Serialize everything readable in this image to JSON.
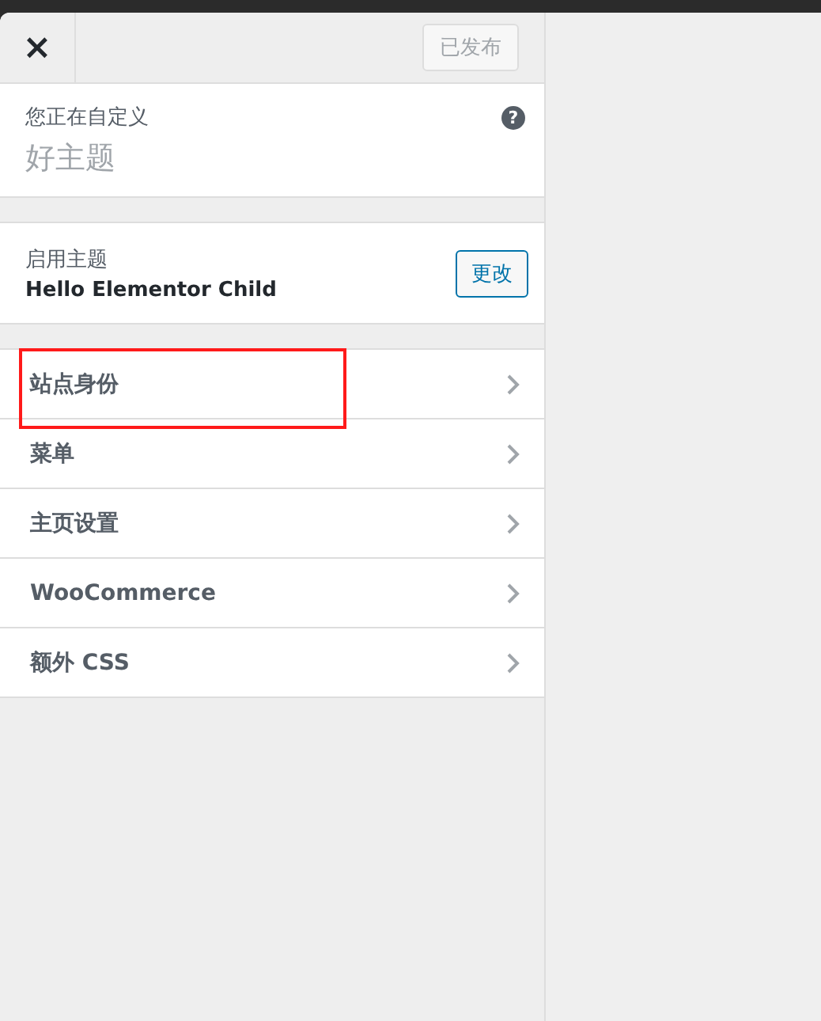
{
  "header": {
    "close_label": "×",
    "publish_button": {
      "label": "已发布",
      "disabled": true
    }
  },
  "info": {
    "caption": "您正在自定义",
    "site_title": "好主题",
    "help_label": "?"
  },
  "active_theme": {
    "caption": "启用主题",
    "name": "Hello Elementor Child",
    "change_button": "更改"
  },
  "sections": [
    {
      "label": "站点身份",
      "highlighted": true
    },
    {
      "label": "菜单",
      "highlighted": false
    },
    {
      "label": "主页设置",
      "highlighted": false
    },
    {
      "label": "WooCommerce",
      "highlighted": false
    },
    {
      "label": "额外 CSS",
      "highlighted": false
    }
  ]
}
